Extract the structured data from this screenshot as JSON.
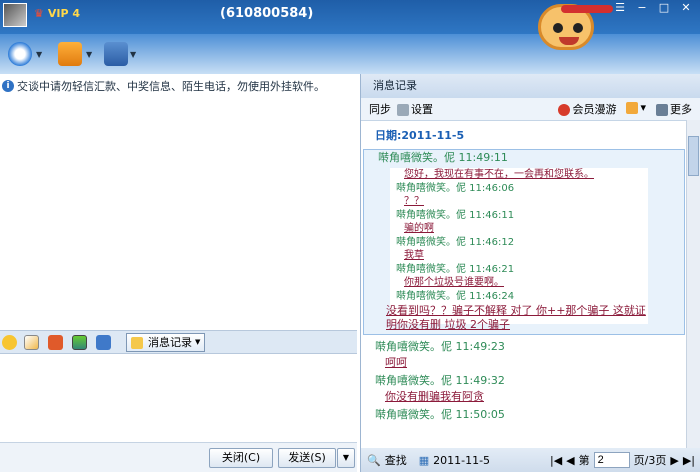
{
  "titlebar": {
    "vip": "VIP 4",
    "qq_number": "(610800584)"
  },
  "left": {
    "notice": "交谈中请勿轻信汇款、中奖信息、陌生电话，勿使用外挂软件。",
    "history_label": "消息记录",
    "close_label": "关闭(C)",
    "send_label": "发送(S)"
  },
  "right": {
    "title": "消息记录",
    "sync": "同步",
    "settings": "设置",
    "member_roam": "会员漫游",
    "more": "更多",
    "date": "日期:2011-11-5",
    "messages": [
      {
        "sender": "啭角嘻微笑。伲 11:49:11"
      },
      {
        "sender": "啭角嘻微笑。伲 11:49:23",
        "text": "呵呵"
      },
      {
        "sender": "啭角嘻微笑。伲 11:49:32",
        "text": "你没有删骗我有阿贪"
      },
      {
        "sender": "啭角嘻微笑。伲 11:50:05"
      }
    ],
    "embedded": [
      {
        "text": "您好，我现在有事不在，一会再和您联系。"
      },
      {
        "sender": "啭角嘻微笑。伲 11:46:06",
        "text": "？？"
      },
      {
        "sender": "啭角嘻微笑。伲 11:46:11",
        "text": "骗的啊"
      },
      {
        "sender": "啭角嘻微笑。伲 11:46:12",
        "text": "我草"
      },
      {
        "sender": "啭角嘻微笑。伲 11:46:21",
        "text": "你那个垃圾号谁要啊。"
      },
      {
        "sender": "啭角嘻微笑。伲 11:46:24"
      }
    ],
    "long_text": "没看到吗？？骗子不解释   对了   你++那个骗子    这就证明你没有删   垃圾 2个骗子",
    "pager": {
      "find": "查找",
      "date": "2011-11-5",
      "page_prefix": "第",
      "page_value": "2",
      "page_suffix": "页/3页"
    }
  }
}
